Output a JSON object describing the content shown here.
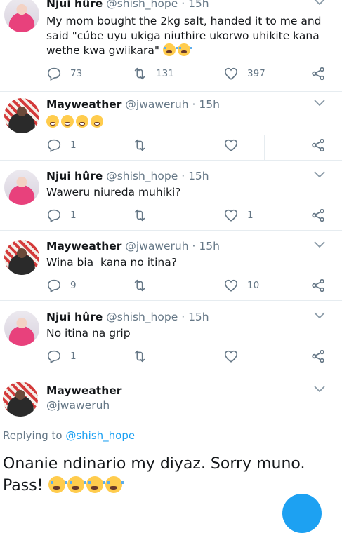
{
  "tweets": [
    {
      "name": "Njui hûre",
      "handle": "@shish_hope",
      "time": "15h",
      "text": "My mom bought the 2kg salt, handed it to me and said \"cúbe uyu ukiga niuthire ukorwo uhikite kana wethe kwa gwiikara\"",
      "replies": "73",
      "retweets": "131",
      "likes": "397"
    },
    {
      "name": "Mayweather",
      "handle": "@jwaweruh",
      "time": "15h",
      "text": "",
      "replies": "1",
      "retweets": "",
      "likes": ""
    },
    {
      "name": "Njui hûre",
      "handle": "@shish_hope",
      "time": "15h",
      "text": "Waweru niureda muhiki?",
      "replies": "1",
      "retweets": "",
      "likes": "1"
    },
    {
      "name": "Mayweather",
      "handle": "@jwaweruh",
      "time": "15h",
      "text": "Wina bia  kana no itina?",
      "replies": "9",
      "retweets": "",
      "likes": "10"
    },
    {
      "name": "Njui hûre",
      "handle": "@shish_hope",
      "time": "15h",
      "text": "No itina na grip",
      "replies": "1",
      "retweets": "",
      "likes": ""
    }
  ],
  "main_tweet": {
    "name": "Mayweather",
    "handle": "@jwaweruh",
    "replying_prefix": "Replying to",
    "replying_to": "@shish_hope",
    "text": "Onanie ndinario my diyaz. Sorry muno. Pass!"
  },
  "separator": "·",
  "icons": {
    "reply": "reply-icon",
    "retweet": "retweet-icon",
    "like": "heart-icon",
    "share": "share-icon",
    "caret": "chevron-down-icon",
    "emoji_cry": "loudly-crying-face-emoji",
    "emoji_laugh": "grinning-face-emoji"
  },
  "colors": {
    "text": "#14171a",
    "secondary": "#657786",
    "link": "#1da1f2",
    "divider": "#e6ecf0"
  }
}
